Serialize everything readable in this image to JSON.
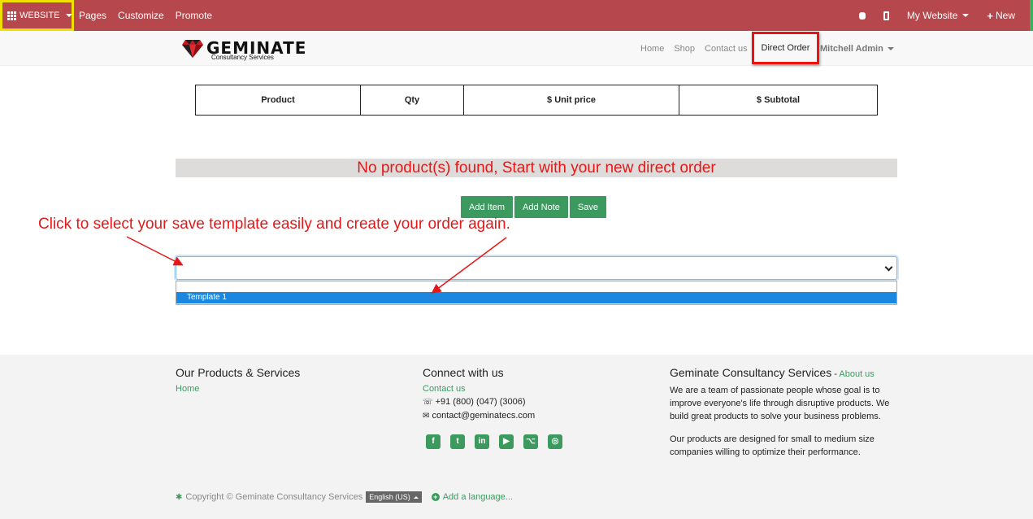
{
  "topbar": {
    "website_label": "WEBSITE",
    "pages": "Pages",
    "customize": "Customize",
    "promote": "Promote",
    "my_website": "My Website",
    "new": "New",
    "accent": "#b6474c"
  },
  "navbar": {
    "logo": "GEMINATE",
    "logo_sub": "Consultancy Services",
    "home": "Home",
    "shop": "Shop",
    "contact": "Contact us",
    "direct_order": "Direct Order",
    "user": "Mitchell Admin"
  },
  "table": {
    "headers": [
      "Product",
      "Qty",
      "$ Unit price",
      "$ Subtotal"
    ]
  },
  "no_product_msg": "No product(s) found, Start with your new direct order",
  "buttons": {
    "add_item": "Add Item",
    "add_note": "Add Note",
    "save": "Save"
  },
  "annotation": "Click to select your save template easily and create your order again.",
  "template_select": {
    "value": "",
    "options": [
      "Template 1"
    ]
  },
  "footer": {
    "col1": {
      "title": "Our Products & Services",
      "home": "Home"
    },
    "col2": {
      "title": "Connect with us",
      "contact": "Contact us",
      "phone": "+91 (800) (047) (3006)",
      "email": "contact@geminatecs.com"
    },
    "col3": {
      "title": "Geminate Consultancy Services",
      "about_sep": " - ",
      "about": "About us",
      "p1": "We are a team of passionate people whose goal is to improve everyone's life through disruptive products. We build great products to solve your business problems.",
      "p2": "Our products are designed for small to medium size companies willing to optimize their performance."
    },
    "copyright": "Copyright © Geminate Consultancy Services",
    "language": "English (US)",
    "add_language": "Add a language..."
  }
}
